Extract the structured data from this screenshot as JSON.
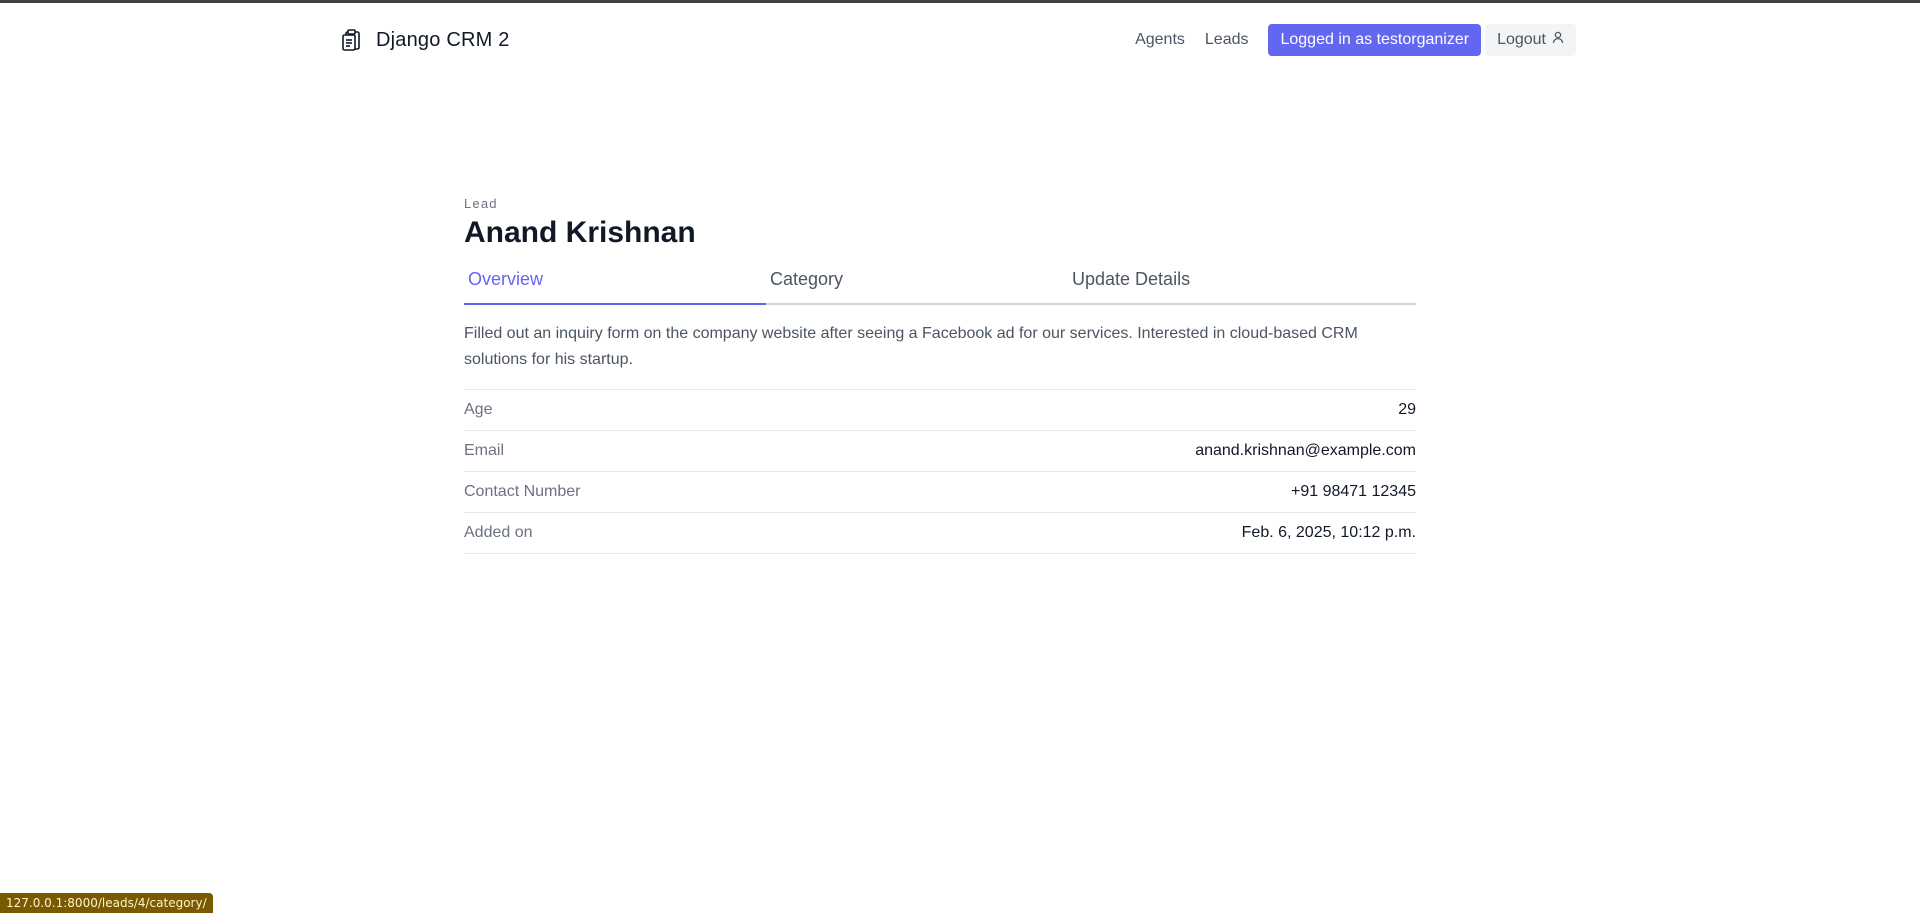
{
  "header": {
    "brand_title": "Django CRM 2",
    "brand_icon": "clipboard-icon",
    "nav_agents": "Agents",
    "nav_leads": "Leads",
    "logged_in_label": "Logged in as testorganizer",
    "logout_label": "Logout",
    "logout_icon": "user-icon"
  },
  "lead": {
    "eyebrow": "Lead",
    "name": "Anand Krishnan",
    "tabs": [
      {
        "label": "Overview",
        "active": true
      },
      {
        "label": "Category",
        "active": false
      },
      {
        "label": "Update Details",
        "active": false
      }
    ],
    "description": "Filled out an inquiry form on the company website after seeing a Facebook ad for our services. Interested in cloud-based CRM solutions for his startup.",
    "details": [
      {
        "label": "Age",
        "value": "29"
      },
      {
        "label": "Email",
        "value": "anand.krishnan@example.com"
      },
      {
        "label": "Contact Number",
        "value": "+91 98471 12345"
      },
      {
        "label": "Added on",
        "value": "Feb. 6, 2025, 10:12 p.m."
      }
    ]
  },
  "status_bar": {
    "url": "127.0.0.1:8000/leads/4/category/"
  },
  "colors": {
    "accent": "#6366f1",
    "text_muted": "#6b7280"
  }
}
